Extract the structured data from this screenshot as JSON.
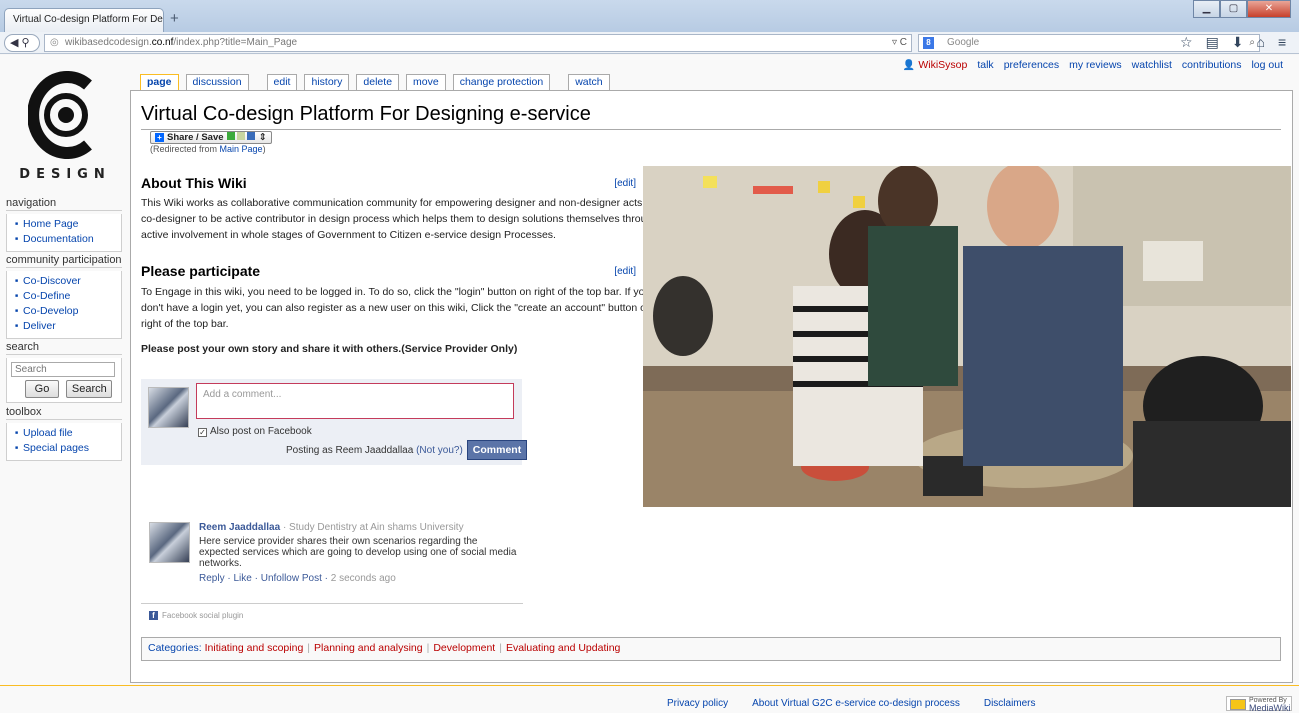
{
  "browser": {
    "tab_title": "Virtual Co-design Platform For Des...",
    "new_tab": "+",
    "url_domain_prefix": "wikibasedcodesign.",
    "url_domain_bold": "co.nf",
    "url_path": "/index.php?title=Main_Page",
    "search_placeholder": "Google",
    "window_buttons": [
      "▁",
      "▢",
      "✕"
    ],
    "toolbar_icons": [
      "search-icon",
      "star-icon",
      "reading-list-icon",
      "download-icon",
      "home-icon",
      "menu-icon"
    ]
  },
  "logo": {
    "text": "DESIGN",
    "mark": "C"
  },
  "sidebar": {
    "navigation": {
      "title": "navigation",
      "items": [
        "Home Page",
        "Documentation"
      ]
    },
    "community": {
      "title": "community participation",
      "items": [
        "Co-Discover",
        "Co-Define",
        "Co-Develop",
        "Deliver"
      ]
    },
    "search": {
      "title": "search",
      "placeholder": "Search",
      "go": "Go",
      "search": "Search"
    },
    "toolbox": {
      "title": "toolbox",
      "items": [
        "Upload file",
        "Special pages"
      ]
    }
  },
  "page_tabs": [
    "page",
    "discussion",
    "edit",
    "history",
    "delete",
    "move",
    "change protection",
    "watch"
  ],
  "user_bar": {
    "user": "WikiSysop",
    "links": [
      "talk",
      "preferences",
      "my reviews",
      "watchlist",
      "contributions",
      "log out"
    ]
  },
  "article": {
    "title": "Virtual Co-design Platform For Designing e-service",
    "share_label": "Share / Save",
    "redirect_prefix": "(Redirected from ",
    "redirect_link": "Main Page",
    "redirect_suffix": ")",
    "edit_label": "[edit]",
    "sections": [
      {
        "heading": "About This Wiki",
        "text": "This Wiki works as collaborative communication community for empowering designer and non-designer acts as co-designer to be active contributor in design process which helps them to design solutions themselves through active involvement in whole stages of Government to Citizen e-service design Processes."
      },
      {
        "heading": "Please participate",
        "text": "To Engage in this wiki, you need to be logged in. To do so, click the \"login\" button on right of the top bar. If you don't have a login yet, you can also register as a new user on this wiki, Click the \"create an account\" button on right of the top bar."
      }
    ],
    "bold_note": "Please post your own story and share it with others.(Service Provider Only)"
  },
  "facebook": {
    "placeholder": "Add a comment...",
    "also_post": "Also post on Facebook",
    "posting_as": "Posting as Reem Jaaddallaa",
    "not_you": "(Not you?)",
    "comment_button": "Comment",
    "comment": {
      "author": "Reem Jaaddallaa",
      "meta": " · Study Dentistry at Ain shams University",
      "text": "Here service provider shares their own scenarios regarding the expected services which are going to develop using one of social media networks.",
      "reply": "Reply",
      "like": "Like",
      "unfollow": "Unfollow Post",
      "time": "2 seconds ago"
    },
    "plugin_label": "Facebook social plugin"
  },
  "categories": {
    "label": "Categories:",
    "items": [
      "Initiating and scoping",
      "Planning and analysing",
      "Development",
      "Evaluating and Updating"
    ]
  },
  "footer": {
    "links": [
      "Privacy policy",
      "About Virtual G2C e-service co-design process",
      "Disclaimers"
    ],
    "badge_line1": "Powered By",
    "badge_line2": "MediaWiki"
  },
  "colors": {
    "redlink": "#ba0000",
    "link": "#0645ad",
    "facebook": "#3b5998",
    "tab_active_border": "#fabd23"
  }
}
